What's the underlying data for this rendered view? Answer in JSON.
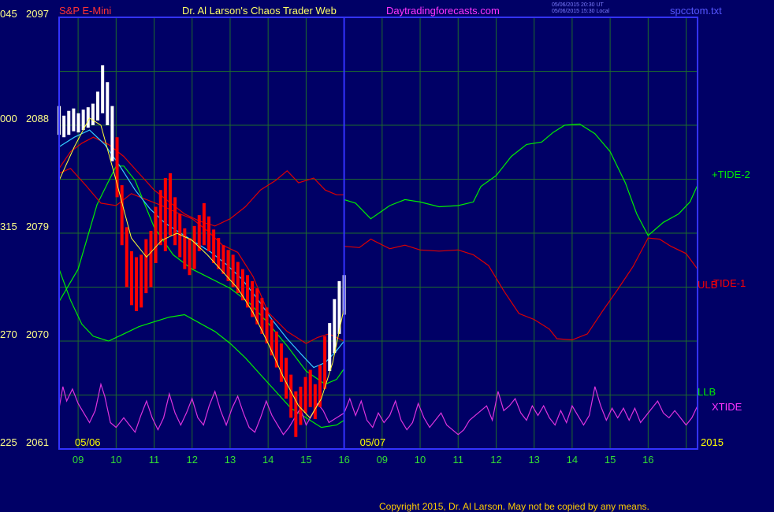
{
  "header": {
    "instrument": "S&P E-Mini",
    "site": "Dr. Al Larson's Chaos Trader Web",
    "url": "Daytradingforecasts.com",
    "ts_utc": "05/06/2015 20:30 UT",
    "ts_local": "05/06/2015 15:30 Local",
    "file": "spcctom.txt"
  },
  "footer": {
    "copyright": "Copyright 2015, Dr. Al Larson. May not be copied by any means."
  },
  "colors": {
    "background": "#000066",
    "frame": "#3333ff",
    "grid": "#1e6b2c",
    "price": "#ffffff",
    "red_candle": "#ff0000",
    "tide2": "#00ee00",
    "tide1": "#dd0000",
    "xtide": "#dd33dd",
    "cyan": "#33ccff",
    "yellow": "#ffff33",
    "date_label": "#ffff00",
    "hour_label": "#33dd33",
    "price_label": "#ffff88",
    "title_red": "#ff3333"
  },
  "chart_data": {
    "type": "line",
    "title": "S&P E-Mini",
    "y_ticks": [
      {
        "left": "045",
        "right": "2097"
      },
      {
        "left": "000",
        "right": "2088"
      },
      {
        "left": "315",
        "right": "2079"
      },
      {
        "left": "270",
        "right": "2070"
      },
      {
        "left": "225",
        "right": "2061"
      }
    ],
    "ylim": [
      2061,
      2097
    ],
    "x_hours": [
      "09",
      "10",
      "11",
      "12",
      "13",
      "14",
      "15",
      "16",
      "09",
      "10",
      "11",
      "12",
      "13",
      "14",
      "15",
      "16"
    ],
    "session_dates": [
      "05/06",
      "05/07"
    ],
    "year": "2015",
    "series_labels": [
      {
        "name": "+TIDE-2",
        "color": "#00ee00"
      },
      {
        "name": "ULB",
        "color": "#ff0000"
      },
      {
        "name": "TIDE-1",
        "color": "#ff0000"
      },
      {
        "name": "LLB",
        "color": "#00ee00"
      },
      {
        "name": "XTIDE",
        "color": "#ff33ff"
      }
    ],
    "price_bars": [
      [
        2087.2,
        2089.6
      ],
      [
        2087.0,
        2088.8
      ],
      [
        2087.2,
        2089.2
      ],
      [
        2087.5,
        2089.4
      ],
      [
        2087.4,
        2089.0
      ],
      [
        2087.6,
        2089.3
      ],
      [
        2087.8,
        2089.5
      ],
      [
        2088.0,
        2089.8
      ],
      [
        2088.4,
        2090.8
      ],
      [
        2089.0,
        2093.0
      ],
      [
        2088.0,
        2091.6
      ],
      [
        2085.0,
        2089.6
      ],
      [
        2082.0,
        2087.0
      ],
      [
        2078.0,
        2083.0
      ],
      [
        2074.5,
        2079.5
      ],
      [
        2073.0,
        2077.5
      ],
      [
        2072.5,
        2077.0
      ],
      [
        2072.8,
        2077.2
      ],
      [
        2074.0,
        2078.5
      ],
      [
        2074.5,
        2079.2
      ],
      [
        2076.5,
        2081.2
      ],
      [
        2078.0,
        2082.6
      ],
      [
        2077.5,
        2083.6
      ],
      [
        2078.8,
        2084.0
      ],
      [
        2078.0,
        2082.0
      ],
      [
        2077.0,
        2080.6
      ],
      [
        2076.0,
        2079.4
      ],
      [
        2075.5,
        2078.6
      ],
      [
        2076.0,
        2079.6
      ],
      [
        2077.5,
        2080.5
      ],
      [
        2078.0,
        2081.5
      ],
      [
        2077.5,
        2080.4
      ],
      [
        2076.5,
        2079.3
      ],
      [
        2076.0,
        2078.6
      ],
      [
        2075.6,
        2078.0
      ],
      [
        2075.0,
        2077.6
      ],
      [
        2074.5,
        2077.2
      ],
      [
        2074.0,
        2076.6
      ],
      [
        2073.4,
        2076.0
      ],
      [
        2072.8,
        2075.5
      ],
      [
        2072.0,
        2075.0
      ],
      [
        2071.4,
        2074.4
      ],
      [
        2070.6,
        2073.6
      ],
      [
        2069.8,
        2072.8
      ],
      [
        2068.8,
        2071.8
      ],
      [
        2067.8,
        2070.8
      ],
      [
        2066.6,
        2069.8
      ],
      [
        2065.2,
        2068.6
      ],
      [
        2063.6,
        2067.2
      ],
      [
        2062.0,
        2065.8
      ],
      [
        2063.0,
        2066.2
      ],
      [
        2064.0,
        2067.0
      ],
      [
        2064.5,
        2067.6
      ],
      [
        2063.5,
        2066.4
      ],
      [
        2064.5,
        2068.0
      ],
      [
        2066.0,
        2070.4
      ],
      [
        2067.5,
        2071.5
      ],
      [
        2069.0,
        2073.5
      ],
      [
        2070.6,
        2075.0
      ],
      [
        2072.2,
        2075.5
      ]
    ],
    "tide2": [
      [
        8.5,
        2073.3
      ],
      [
        9.0,
        2076.0
      ],
      [
        9.5,
        2081.4
      ],
      [
        10.0,
        2084.6
      ],
      [
        10.2,
        2084.6
      ],
      [
        10.5,
        2083.4
      ],
      [
        11.0,
        2079.5
      ],
      [
        11.5,
        2077.2
      ],
      [
        12.0,
        2076.0
      ],
      [
        12.5,
        2075.2
      ],
      [
        13.0,
        2074.4
      ],
      [
        13.5,
        2073.2
      ],
      [
        14.0,
        2071.5
      ],
      [
        14.5,
        2069.6
      ],
      [
        15.0,
        2067.5
      ],
      [
        15.5,
        2066.4
      ],
      [
        15.8,
        2066.8
      ],
      [
        16.0,
        2067.7
      ],
      [
        16.0,
        2081.8
      ],
      [
        16.3,
        2081.5
      ],
      [
        16.7,
        2080.2
      ],
      [
        17.2,
        2081.3
      ],
      [
        17.6,
        2081.8
      ],
      [
        18.0,
        2081.6
      ],
      [
        18.5,
        2081.2
      ],
      [
        19.0,
        2081.3
      ],
      [
        19.4,
        2081.6
      ],
      [
        19.6,
        2082.9
      ],
      [
        20.0,
        2083.8
      ],
      [
        20.4,
        2085.4
      ],
      [
        20.8,
        2086.4
      ],
      [
        21.2,
        2086.6
      ],
      [
        21.5,
        2087.4
      ],
      [
        21.8,
        2088.0
      ],
      [
        22.2,
        2088.1
      ],
      [
        22.6,
        2087.3
      ],
      [
        23.0,
        2085.8
      ],
      [
        23.4,
        2083.2
      ],
      [
        23.7,
        2080.6
      ],
      [
        24.0,
        2078.8
      ],
      [
        24.4,
        2079.9
      ],
      [
        24.8,
        2080.6
      ],
      [
        25.1,
        2081.6
      ],
      [
        25.3,
        2083.0
      ]
    ],
    "tide1": [
      [
        8.5,
        2084.0
      ],
      [
        8.8,
        2084.4
      ],
      [
        9.2,
        2083.0
      ],
      [
        9.6,
        2081.5
      ],
      [
        10.0,
        2081.3
      ],
      [
        10.4,
        2082.3
      ],
      [
        10.8,
        2081.8
      ],
      [
        11.2,
        2081.3
      ],
      [
        11.6,
        2080.7
      ],
      [
        12.0,
        2080.2
      ],
      [
        12.4,
        2079.2
      ],
      [
        12.8,
        2078.0
      ],
      [
        13.2,
        2077.4
      ],
      [
        13.6,
        2075.4
      ],
      [
        14.0,
        2072.4
      ],
      [
        14.5,
        2070.8
      ],
      [
        15.0,
        2069.8
      ],
      [
        15.3,
        2070.3
      ],
      [
        15.6,
        2070.6
      ],
      [
        16.0,
        2070.0
      ],
      [
        16.0,
        2077.9
      ],
      [
        16.4,
        2077.8
      ],
      [
        16.7,
        2078.5
      ],
      [
        17.2,
        2077.7
      ],
      [
        17.6,
        2078.0
      ],
      [
        18.0,
        2077.6
      ],
      [
        18.5,
        2077.5
      ],
      [
        19.0,
        2077.6
      ],
      [
        19.4,
        2077.2
      ],
      [
        19.8,
        2076.3
      ],
      [
        20.2,
        2074.2
      ],
      [
        20.6,
        2072.3
      ],
      [
        21.0,
        2071.8
      ],
      [
        21.4,
        2071.0
      ],
      [
        21.6,
        2070.2
      ],
      [
        22.0,
        2070.1
      ],
      [
        22.4,
        2070.6
      ],
      [
        22.8,
        2072.5
      ],
      [
        23.2,
        2074.3
      ],
      [
        23.6,
        2076.2
      ],
      [
        24.0,
        2078.6
      ],
      [
        24.3,
        2078.5
      ],
      [
        24.6,
        2077.9
      ],
      [
        25.0,
        2077.3
      ],
      [
        25.3,
        2076.0
      ]
    ],
    "ulb": [
      [
        8.5,
        2084.4
      ],
      [
        8.8,
        2085.8
      ],
      [
        9.1,
        2086.5
      ],
      [
        9.4,
        2087.0
      ],
      [
        9.8,
        2086.4
      ],
      [
        10.2,
        2085.4
      ],
      [
        10.6,
        2084.0
      ],
      [
        11.0,
        2082.6
      ],
      [
        11.4,
        2081.6
      ],
      [
        11.8,
        2080.6
      ],
      [
        12.2,
        2080.0
      ],
      [
        12.6,
        2079.6
      ],
      [
        13.0,
        2080.2
      ],
      [
        13.4,
        2081.2
      ],
      [
        13.8,
        2082.6
      ],
      [
        14.2,
        2083.4
      ],
      [
        14.5,
        2084.2
      ],
      [
        14.8,
        2083.2
      ],
      [
        15.2,
        2083.6
      ],
      [
        15.5,
        2082.6
      ],
      [
        15.8,
        2082.2
      ],
      [
        16.0,
        2082.2
      ]
    ],
    "llb": [
      [
        8.5,
        2076.0
      ],
      [
        8.8,
        2073.4
      ],
      [
        9.1,
        2071.4
      ],
      [
        9.4,
        2070.4
      ],
      [
        9.8,
        2070.0
      ],
      [
        10.2,
        2070.6
      ],
      [
        10.6,
        2071.2
      ],
      [
        11.0,
        2071.6
      ],
      [
        11.4,
        2072.0
      ],
      [
        11.8,
        2072.2
      ],
      [
        12.2,
        2071.5
      ],
      [
        12.6,
        2070.8
      ],
      [
        13.0,
        2069.8
      ],
      [
        13.4,
        2068.6
      ],
      [
        13.8,
        2067.2
      ],
      [
        14.2,
        2065.8
      ],
      [
        14.6,
        2064.4
      ],
      [
        15.0,
        2063.6
      ],
      [
        15.4,
        2062.8
      ],
      [
        15.8,
        2063.0
      ],
      [
        16.0,
        2063.4
      ]
    ],
    "cyan": [
      [
        8.5,
        2086.2
      ],
      [
        8.9,
        2087.0
      ],
      [
        9.3,
        2087.6
      ],
      [
        9.7,
        2086.4
      ],
      [
        10.1,
        2084.6
      ],
      [
        10.5,
        2082.6
      ],
      [
        10.9,
        2081.0
      ],
      [
        11.3,
        2079.8
      ],
      [
        11.7,
        2079.0
      ],
      [
        12.1,
        2078.2
      ],
      [
        12.5,
        2077.4
      ],
      [
        12.9,
        2076.4
      ],
      [
        13.3,
        2075.2
      ],
      [
        13.7,
        2073.6
      ],
      [
        14.1,
        2071.8
      ],
      [
        14.5,
        2070.2
      ],
      [
        14.9,
        2068.8
      ],
      [
        15.2,
        2067.8
      ],
      [
        15.5,
        2068.2
      ],
      [
        15.8,
        2069.2
      ],
      [
        16.0,
        2070.0
      ]
    ],
    "yellow": [
      [
        8.5,
        2083.4
      ],
      [
        8.9,
        2086.2
      ],
      [
        9.3,
        2088.6
      ],
      [
        9.6,
        2088.0
      ],
      [
        10.0,
        2083.4
      ],
      [
        10.4,
        2078.6
      ],
      [
        10.8,
        2077.0
      ],
      [
        11.2,
        2078.4
      ],
      [
        11.6,
        2079.0
      ],
      [
        12.0,
        2078.4
      ],
      [
        12.4,
        2077.2
      ],
      [
        12.8,
        2075.8
      ],
      [
        13.2,
        2074.4
      ],
      [
        13.6,
        2072.4
      ],
      [
        14.0,
        2069.8
      ],
      [
        14.4,
        2067.0
      ],
      [
        14.8,
        2064.6
      ],
      [
        15.1,
        2063.6
      ],
      [
        15.4,
        2065.2
      ],
      [
        15.7,
        2068.2
      ],
      [
        16.0,
        2072.8
      ]
    ],
    "xtide": [
      [
        8.5,
        2064.4
      ],
      [
        8.6,
        2066.2
      ],
      [
        8.7,
        2065.0
      ],
      [
        8.85,
        2066.0
      ],
      [
        9.0,
        2064.8
      ],
      [
        9.15,
        2064.0
      ],
      [
        9.3,
        2063.2
      ],
      [
        9.45,
        2064.2
      ],
      [
        9.6,
        2066.4
      ],
      [
        9.7,
        2065.4
      ],
      [
        9.85,
        2063.2
      ],
      [
        10.0,
        2062.8
      ],
      [
        10.2,
        2063.6
      ],
      [
        10.35,
        2063.0
      ],
      [
        10.5,
        2062.4
      ],
      [
        10.65,
        2063.8
      ],
      [
        10.8,
        2065.0
      ],
      [
        10.95,
        2063.6
      ],
      [
        11.1,
        2062.6
      ],
      [
        11.25,
        2063.6
      ],
      [
        11.4,
        2065.6
      ],
      [
        11.55,
        2064.0
      ],
      [
        11.7,
        2063.0
      ],
      [
        11.85,
        2064.0
      ],
      [
        12.0,
        2065.2
      ],
      [
        12.15,
        2063.6
      ],
      [
        12.3,
        2063.0
      ],
      [
        12.45,
        2064.6
      ],
      [
        12.6,
        2065.8
      ],
      [
        12.75,
        2064.2
      ],
      [
        12.9,
        2063.0
      ],
      [
        13.05,
        2064.4
      ],
      [
        13.2,
        2065.4
      ],
      [
        13.35,
        2064.0
      ],
      [
        13.5,
        2062.8
      ],
      [
        13.65,
        2062.4
      ],
      [
        13.8,
        2063.6
      ],
      [
        13.95,
        2065.0
      ],
      [
        14.1,
        2063.8
      ],
      [
        14.25,
        2063.0
      ],
      [
        14.4,
        2062.2
      ],
      [
        14.55,
        2062.8
      ],
      [
        14.7,
        2063.6
      ],
      [
        14.85,
        2064.4
      ],
      [
        15.0,
        2063.0
      ],
      [
        15.15,
        2063.8
      ],
      [
        15.3,
        2064.8
      ],
      [
        15.45,
        2064.2
      ],
      [
        15.6,
        2063.2
      ],
      [
        15.8,
        2063.6
      ],
      [
        16.0,
        2064.0
      ],
      [
        16.15,
        2065.2
      ],
      [
        16.3,
        2063.8
      ],
      [
        16.45,
        2065.0
      ],
      [
        16.6,
        2063.4
      ],
      [
        16.75,
        2062.8
      ],
      [
        16.9,
        2064.0
      ],
      [
        17.05,
        2063.2
      ],
      [
        17.2,
        2063.8
      ],
      [
        17.35,
        2065.0
      ],
      [
        17.5,
        2063.4
      ],
      [
        17.65,
        2062.6
      ],
      [
        17.8,
        2063.2
      ],
      [
        17.95,
        2064.8
      ],
      [
        18.1,
        2063.6
      ],
      [
        18.25,
        2062.8
      ],
      [
        18.4,
        2063.4
      ],
      [
        18.55,
        2064.0
      ],
      [
        18.7,
        2063.0
      ],
      [
        18.85,
        2062.6
      ],
      [
        19.0,
        2062.2
      ],
      [
        19.15,
        2062.6
      ],
      [
        19.3,
        2063.4
      ],
      [
        19.45,
        2063.8
      ],
      [
        19.6,
        2064.2
      ],
      [
        19.75,
        2064.6
      ],
      [
        19.9,
        2063.4
      ],
      [
        20.05,
        2065.8
      ],
      [
        20.2,
        2064.2
      ],
      [
        20.35,
        2064.6
      ],
      [
        20.5,
        2065.2
      ],
      [
        20.65,
        2064.0
      ],
      [
        20.8,
        2063.4
      ],
      [
        20.95,
        2064.6
      ],
      [
        21.1,
        2063.8
      ],
      [
        21.25,
        2064.6
      ],
      [
        21.4,
        2063.6
      ],
      [
        21.55,
        2063.0
      ],
      [
        21.7,
        2064.2
      ],
      [
        21.85,
        2063.2
      ],
      [
        22.0,
        2064.6
      ],
      [
        22.15,
        2063.8
      ],
      [
        22.3,
        2063.0
      ],
      [
        22.45,
        2063.8
      ],
      [
        22.6,
        2066.2
      ],
      [
        22.75,
        2064.6
      ],
      [
        22.9,
        2063.4
      ],
      [
        23.05,
        2064.4
      ],
      [
        23.2,
        2063.6
      ],
      [
        23.35,
        2064.4
      ],
      [
        23.5,
        2063.4
      ],
      [
        23.65,
        2064.4
      ],
      [
        23.8,
        2063.2
      ],
      [
        23.95,
        2063.8
      ],
      [
        24.1,
        2064.4
      ],
      [
        24.25,
        2065.0
      ],
      [
        24.4,
        2064.0
      ],
      [
        24.55,
        2063.6
      ],
      [
        24.7,
        2064.2
      ],
      [
        24.85,
        2063.6
      ],
      [
        25.0,
        2063.0
      ],
      [
        25.15,
        2063.6
      ],
      [
        25.3,
        2064.6
      ]
    ]
  }
}
